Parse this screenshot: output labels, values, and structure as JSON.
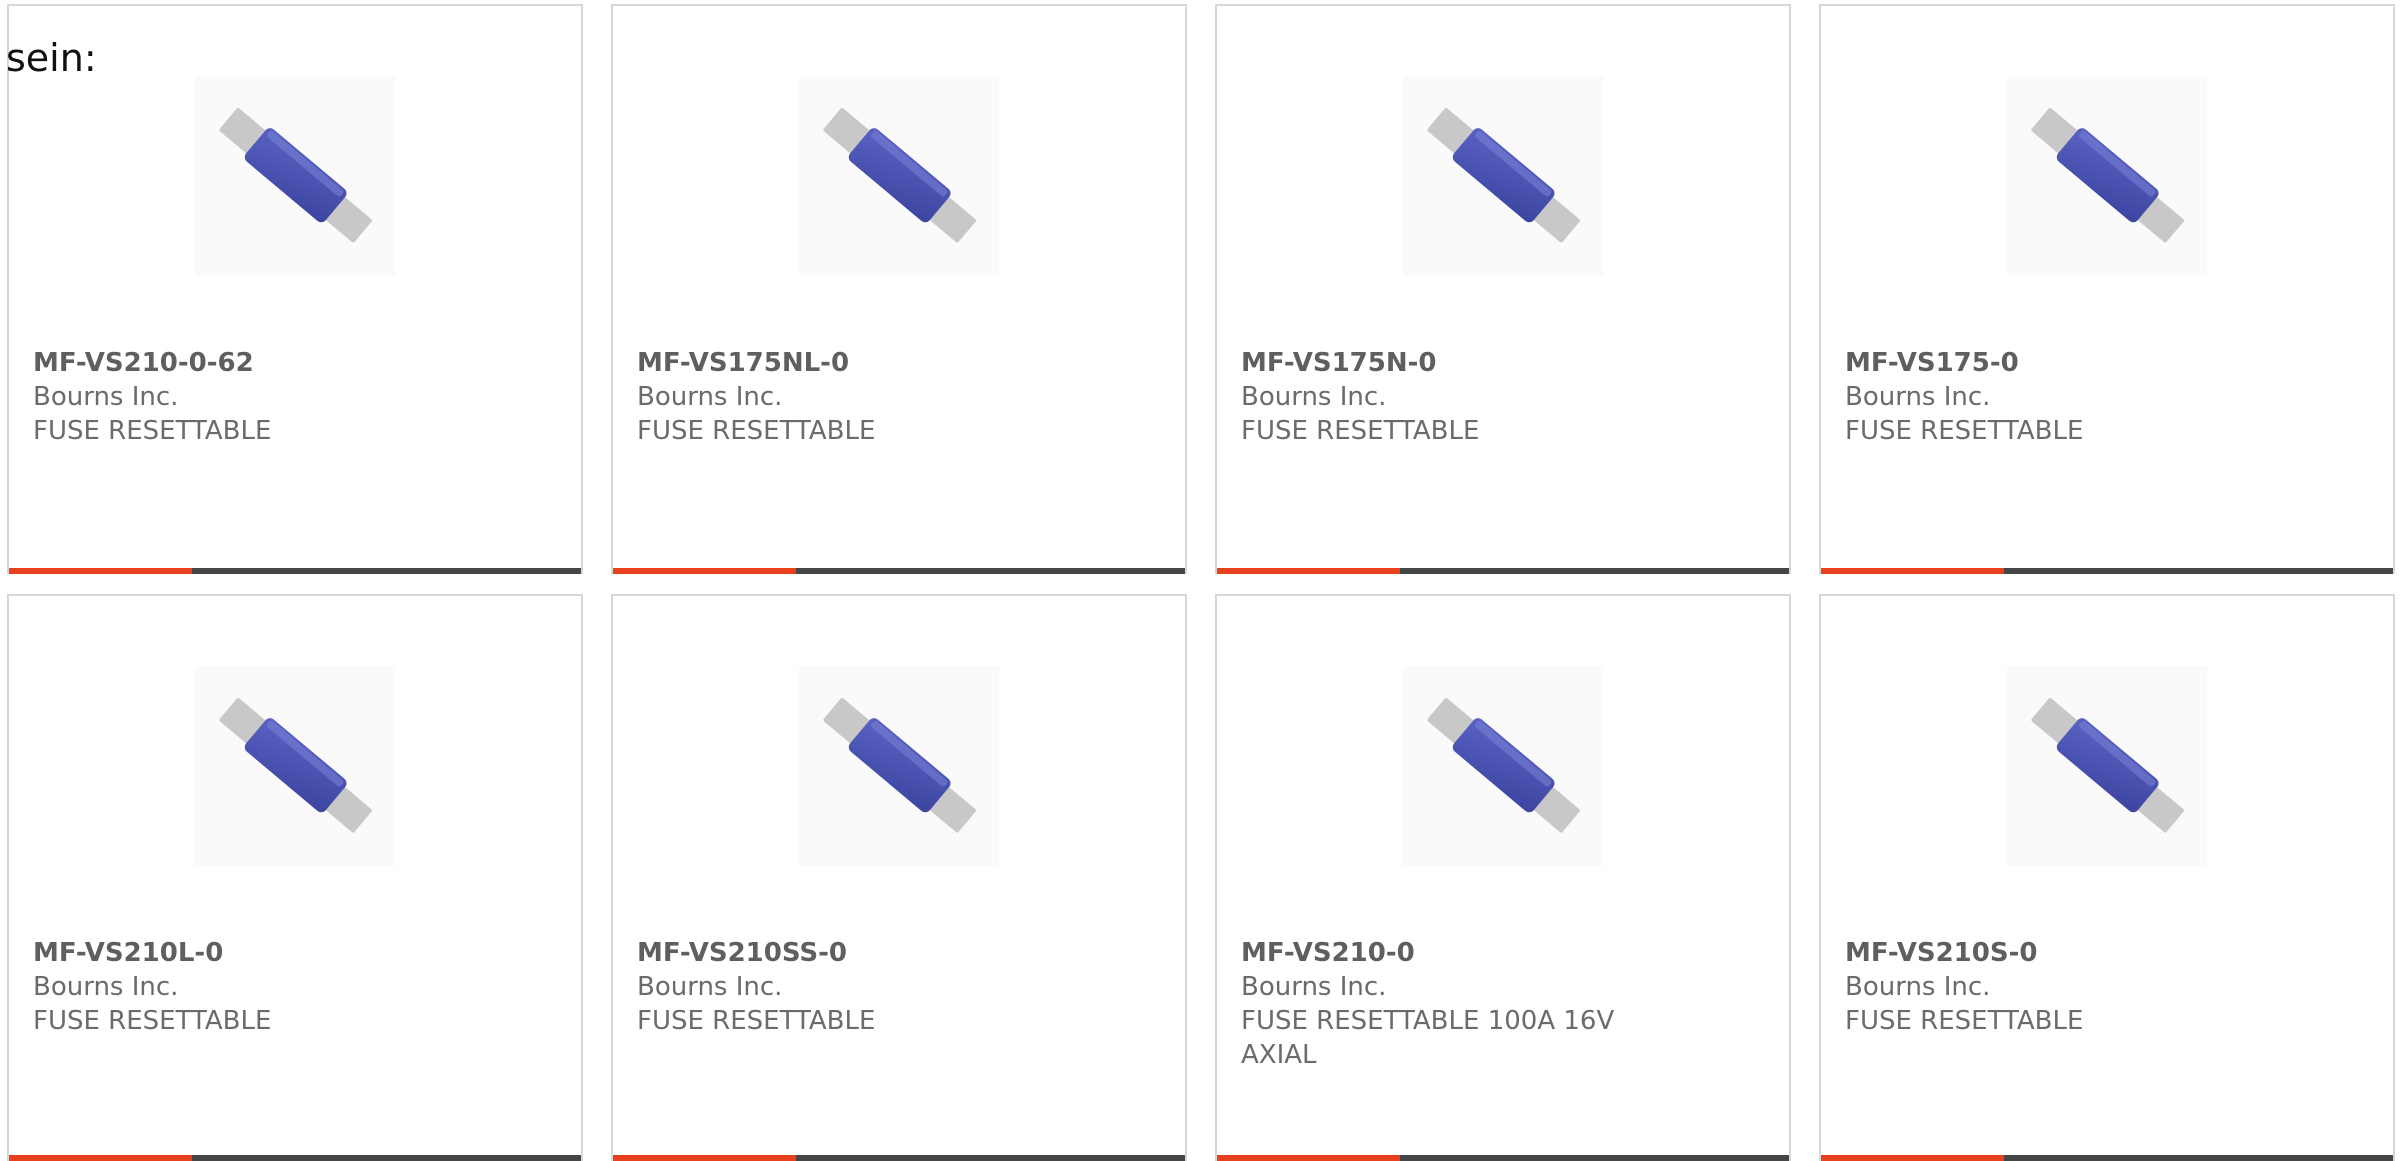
{
  "intro_text": "sein:",
  "colors": {
    "accent_bar": "#e8401c",
    "dark_bar": "#444648",
    "fuse_body": "#4a52b0",
    "fuse_lead": "#c8c8c8"
  },
  "products": [
    {
      "part_number": "MF-VS210-0-62",
      "manufacturer": "Bourns Inc.",
      "description": "FUSE RESETTABLE",
      "icon": "resettable-fuse-image"
    },
    {
      "part_number": "MF-VS175NL-0",
      "manufacturer": "Bourns Inc.",
      "description": "FUSE RESETTABLE",
      "icon": "resettable-fuse-image"
    },
    {
      "part_number": "MF-VS175N-0",
      "manufacturer": "Bourns Inc.",
      "description": "FUSE RESETTABLE",
      "icon": "resettable-fuse-image"
    },
    {
      "part_number": "MF-VS175-0",
      "manufacturer": "Bourns Inc.",
      "description": "FUSE RESETTABLE",
      "icon": "resettable-fuse-image"
    },
    {
      "part_number": "MF-VS210L-0",
      "manufacturer": "Bourns Inc.",
      "description": "FUSE RESETTABLE",
      "icon": "resettable-fuse-image"
    },
    {
      "part_number": "MF-VS210SS-0",
      "manufacturer": "Bourns Inc.",
      "description": "FUSE RESETTABLE",
      "icon": "resettable-fuse-image"
    },
    {
      "part_number": "MF-VS210-0",
      "manufacturer": "Bourns Inc.",
      "description": "FUSE RESETTABLE 100A 16V AXIAL",
      "icon": "resettable-fuse-image"
    },
    {
      "part_number": "MF-VS210S-0",
      "manufacturer": "Bourns Inc.",
      "description": "FUSE RESETTABLE",
      "icon": "resettable-fuse-image"
    }
  ]
}
